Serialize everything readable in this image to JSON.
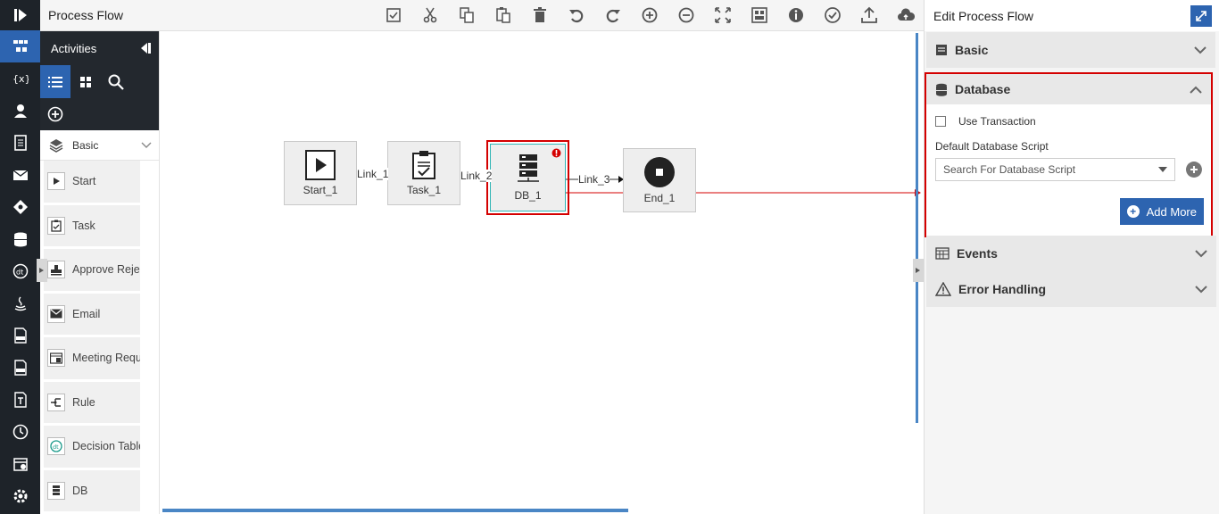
{
  "titlebar": {
    "title": "Process Flow"
  },
  "activities": {
    "title": "Activities",
    "category": "Basic",
    "items": [
      {
        "label": "Start"
      },
      {
        "label": "Task"
      },
      {
        "label": "Approve Reject"
      },
      {
        "label": "Email"
      },
      {
        "label": "Meeting Request"
      },
      {
        "label": "Rule"
      },
      {
        "label": "Decision Table"
      },
      {
        "label": "DB"
      }
    ]
  },
  "canvas": {
    "nodes": {
      "start": "Start_1",
      "task": "Task_1",
      "db": "DB_1",
      "end": "End_1"
    },
    "links": {
      "link1": "Link_1",
      "link2": "Link_2",
      "link3": "Link_3"
    },
    "highlight_color": "#d40000",
    "accent": "#2d64b0"
  },
  "rpanel": {
    "title": "Edit Process Flow",
    "sections": {
      "basic": "Basic",
      "database": "Database",
      "events": "Events",
      "error": "Error Handling"
    },
    "database": {
      "use_transaction": "Use Transaction",
      "script_label": "Default Database Script",
      "script_placeholder": "Search For Database Script",
      "add_more": "Add More"
    }
  }
}
